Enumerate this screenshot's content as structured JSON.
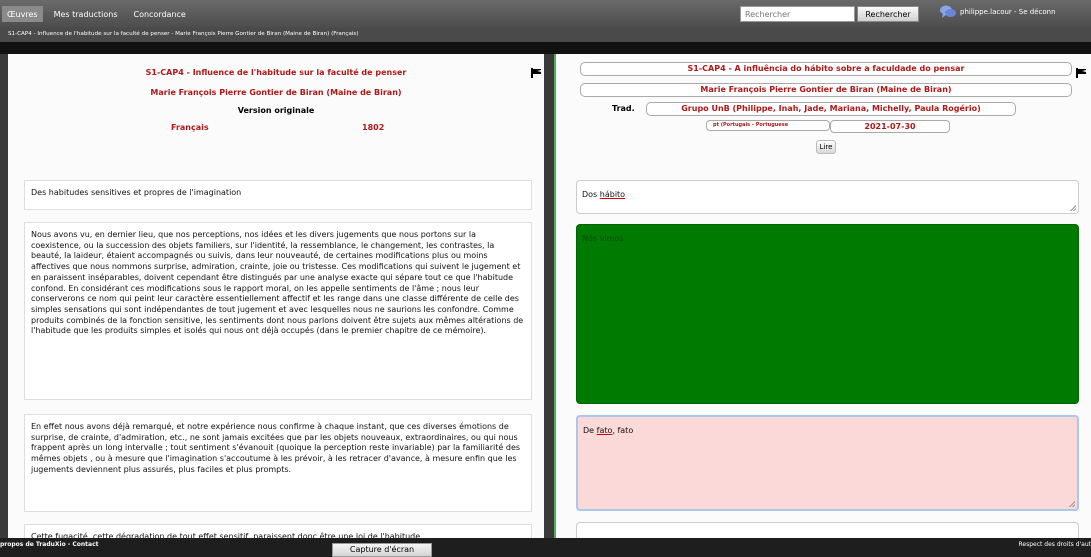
{
  "nav": {
    "items": [
      "Œuvres",
      "Mes traductions",
      "Concordance"
    ],
    "search_placeholder": "Rechercher",
    "search_button": "Rechercher",
    "user": "philippe.lacour - Se déconn"
  },
  "breadcrumb": "S1-CAP4 - Influence de l'habitude sur la faculté de penser - Marie François Pierre Gontier de Biran (Maine de Biran) (Français)",
  "left": {
    "title": "S1-CAP4 - Influence de l'habitude sur la faculté de penser",
    "author": "Marie François Pierre Gontier de Biran (Maine de Biran)",
    "version": "Version originale",
    "language": "Français",
    "year": "1802",
    "segments": [
      "Des habitudes sensitives et propres de l'imagination",
      "Nous avons vu, en dernier lieu, que nos perceptions, nos idées et les divers jugements que nous portons sur la coexistence, ou la succession des objets familiers, sur l'identité, la ressemblance, le changement, les contrastes, la beauté, la laideur, étaient accompagnés ou suivis, dans leur nouveauté, de certaines modifications plus ou moins affectives que nous nommons surprise, admiration, crainte, joie ou tristesse. Ces modifications qui suivent le jugement et en paraissent inséparables, doivent cependant être distingués par une analyse exacte qui sépare tout ce que l'habitude confond. En considérant ces modifications sous le rapport moral, on les appelle sentiments de l'âme ; nous leur conserverons ce nom qui peint leur caractère essentiellement affectif et les range dans une classe différente de celle des simples sensations qui sont indépendantes de tout jugement et avec lesquelles nous ne saurions les confondre. Comme produits combinés de la fonction sensitive, les sentiments dont nous parlons doivent être sujets aux mêmes altérations de l'habitude que les produits simples et isolés qui nous ont déjà occupés (dans le premier chapitre de ce mémoire).",
      "En effet nous avons déjà remarqué, et notre expérience nous confirme à chaque instant, que ces diverses émotions de surprise, de crainte, d'admiration, etc., ne sont jamais excitées que par les objets nouveaux, extraordinaires, ou qui nous frappent après un long intervalle ; tout sentiment s'évanouit (quoique la perception reste invariable) par la familiarité des mêmes objets , ou à mesure que l'imagination s'accoutume à les prévoir, à les retracer d'avance, à mesure enfin que les jugements deviennent plus assurés, plus faciles et plus prompts.",
      "Cette fugacité, cette dégradation de tout effet sensitif, paraissent donc être une loi de l'habitude"
    ]
  },
  "right": {
    "title": "S1-CAP4 - A influência do hábito sobre a faculdade do pensar",
    "author": "Marie François Pierre Gontier de Biran (Maine de Biran)",
    "trad_label": "Trad.",
    "translators": "Grupo UnB (Philippe, Inah, Jade, Mariana, Michelly, Paula Rogério)",
    "language": "pt (Portugais - Portuguese",
    "date": "2021-07-30",
    "read_button": "Lire",
    "segments": {
      "s1_a": "Dos ",
      "s1_b": "hábito",
      "s2": "Nós vimos",
      "s3_a": "De ",
      "s3_b": "fato",
      "s3_c": ", fato"
    }
  },
  "footer": {
    "left": "propos de TraduXio - Contact",
    "right": "Respect des droits d'aut",
    "capture_button": "Capture d'écran"
  },
  "colors": {
    "title_red": "#b01818",
    "green_segment": "#007a00",
    "pink_segment": "#fcd9d9",
    "panel_divider": "#4caf50"
  }
}
